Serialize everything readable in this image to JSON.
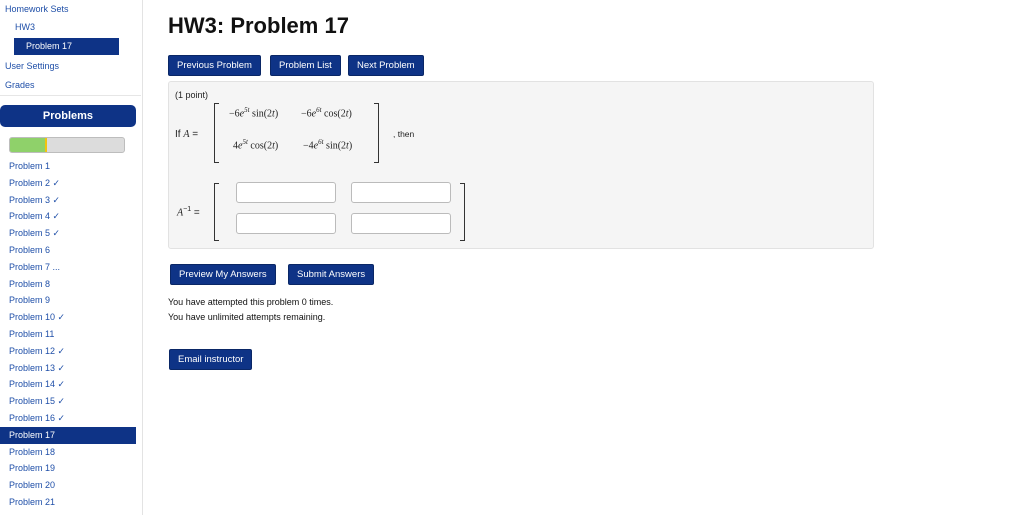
{
  "sidebar": {
    "homework_sets": "Homework Sets",
    "set_name": "HW3",
    "current_problem": "Problem 17",
    "user_settings": "User Settings",
    "grades": "Grades",
    "problems_header": "Problems",
    "progress_fraction": 0.31,
    "problems": [
      "Problem 1",
      "Problem 2 ✓",
      "Problem 3 ✓",
      "Problem 4 ✓",
      "Problem 5 ✓",
      "Problem 6",
      "Problem 7 ...",
      "Problem 8",
      "Problem 9",
      "Problem 10 ✓",
      "Problem 11",
      "Problem 12 ✓",
      "Problem 13 ✓",
      "Problem 14 ✓",
      "Problem 15 ✓",
      "Problem 16 ✓",
      "Problem 17",
      "Problem 18",
      "Problem 19",
      "Problem 20",
      "Problem 21"
    ],
    "current_index": 16
  },
  "main": {
    "title": "HW3: Problem 17",
    "nav_buttons": {
      "previous": "Previous Problem",
      "list": "Problem List",
      "next": "Next Problem"
    },
    "problem": {
      "points": "(1 point)",
      "if_prefix": "If ",
      "matrix_var": "A",
      "equals": " =",
      "matrix": {
        "r1c1": {
          "coef": "−6",
          "exp": "5t",
          "fn": " sin(2",
          "var": "t",
          "close": ")"
        },
        "r1c2": {
          "coef": "−6",
          "exp": "6t",
          "fn": " cos(2",
          "var": "t",
          "close": ")"
        },
        "r2c1": {
          "coef": "4",
          "exp": "5t",
          "fn": " cos(2",
          "var": "t",
          "close": ")"
        },
        "r2c2": {
          "coef": "−4",
          "exp": "6t",
          "fn": " sin(2",
          "var": "t",
          "close": ")"
        },
        "base": "e"
      },
      "then": ", then",
      "inverse_var": "A",
      "inverse_exp": "−1",
      "inverse_eq": " ="
    },
    "answers": [
      "",
      "",
      "",
      ""
    ],
    "action_buttons": {
      "preview": "Preview My Answers",
      "submit": "Submit Answers"
    },
    "attempts_line": "You have attempted this problem 0 times.",
    "remaining_line": "You have unlimited attempts remaining.",
    "email_button": "Email instructor"
  }
}
